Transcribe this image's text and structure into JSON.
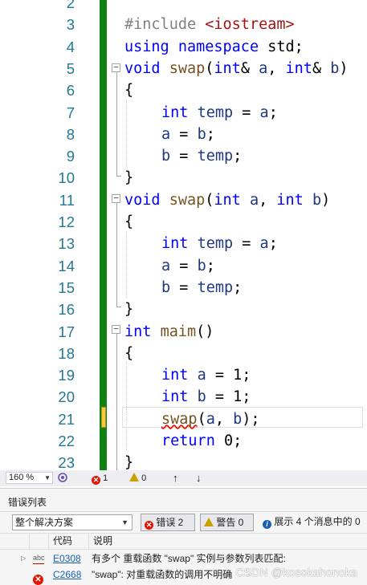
{
  "editor": {
    "lines": [
      {
        "num": "2",
        "indent": 0,
        "tokens": []
      },
      {
        "num": "3",
        "indent": 0,
        "tokens": [
          {
            "t": "#include ",
            "c": "pp"
          },
          {
            "t": "<iostream>",
            "c": "str"
          }
        ]
      },
      {
        "num": "4",
        "indent": 0,
        "tokens": [
          {
            "t": "using",
            "c": "kw"
          },
          {
            "t": " "
          },
          {
            "t": "namespace",
            "c": "kw"
          },
          {
            "t": " std;"
          }
        ]
      },
      {
        "num": "5",
        "indent": 0,
        "tokens": [
          {
            "t": "void",
            "c": "kw"
          },
          {
            "t": " "
          },
          {
            "t": "swap",
            "c": "fn"
          },
          {
            "t": "("
          },
          {
            "t": "int",
            "c": "kw"
          },
          {
            "t": "& "
          },
          {
            "t": "a",
            "c": "var"
          },
          {
            "t": ", "
          },
          {
            "t": "int",
            "c": "kw"
          },
          {
            "t": "& "
          },
          {
            "t": "b",
            "c": "var"
          },
          {
            "t": ")"
          }
        ]
      },
      {
        "num": "6",
        "indent": 0,
        "tokens": [
          {
            "t": "{"
          }
        ]
      },
      {
        "num": "7",
        "indent": 1,
        "tokens": [
          {
            "t": "int",
            "c": "kw"
          },
          {
            "t": " "
          },
          {
            "t": "temp",
            "c": "var"
          },
          {
            "t": " = "
          },
          {
            "t": "a",
            "c": "var"
          },
          {
            "t": ";"
          }
        ]
      },
      {
        "num": "8",
        "indent": 1,
        "tokens": [
          {
            "t": "a",
            "c": "var"
          },
          {
            "t": " = "
          },
          {
            "t": "b",
            "c": "var"
          },
          {
            "t": ";"
          }
        ]
      },
      {
        "num": "9",
        "indent": 1,
        "tokens": [
          {
            "t": "b",
            "c": "var"
          },
          {
            "t": " = "
          },
          {
            "t": "temp",
            "c": "var"
          },
          {
            "t": ";"
          }
        ]
      },
      {
        "num": "10",
        "indent": 0,
        "tokens": [
          {
            "t": "}"
          }
        ]
      },
      {
        "num": "11",
        "indent": 0,
        "tokens": [
          {
            "t": "void",
            "c": "kw"
          },
          {
            "t": " "
          },
          {
            "t": "swap",
            "c": "fn"
          },
          {
            "t": "("
          },
          {
            "t": "int",
            "c": "kw"
          },
          {
            "t": " "
          },
          {
            "t": "a",
            "c": "var"
          },
          {
            "t": ", "
          },
          {
            "t": "int",
            "c": "kw"
          },
          {
            "t": " "
          },
          {
            "t": "b",
            "c": "var"
          },
          {
            "t": ")"
          }
        ]
      },
      {
        "num": "12",
        "indent": 0,
        "tokens": [
          {
            "t": "{"
          }
        ]
      },
      {
        "num": "13",
        "indent": 1,
        "tokens": [
          {
            "t": "int",
            "c": "kw"
          },
          {
            "t": " "
          },
          {
            "t": "temp",
            "c": "var"
          },
          {
            "t": " = "
          },
          {
            "t": "a",
            "c": "var"
          },
          {
            "t": ";"
          }
        ]
      },
      {
        "num": "14",
        "indent": 1,
        "tokens": [
          {
            "t": "a",
            "c": "var"
          },
          {
            "t": " = "
          },
          {
            "t": "b",
            "c": "var"
          },
          {
            "t": ";"
          }
        ]
      },
      {
        "num": "15",
        "indent": 1,
        "tokens": [
          {
            "t": "b",
            "c": "var"
          },
          {
            "t": " = "
          },
          {
            "t": "temp",
            "c": "var"
          },
          {
            "t": ";"
          }
        ]
      },
      {
        "num": "16",
        "indent": 0,
        "tokens": [
          {
            "t": "}"
          }
        ]
      },
      {
        "num": "17",
        "indent": 0,
        "tokens": [
          {
            "t": "int",
            "c": "kw"
          },
          {
            "t": " "
          },
          {
            "t": "maim",
            "c": "fn"
          },
          {
            "t": "()"
          }
        ]
      },
      {
        "num": "18",
        "indent": 0,
        "tokens": [
          {
            "t": "{"
          }
        ]
      },
      {
        "num": "19",
        "indent": 1,
        "tokens": [
          {
            "t": "int",
            "c": "kw"
          },
          {
            "t": " "
          },
          {
            "t": "a",
            "c": "var"
          },
          {
            "t": " = 1;"
          }
        ]
      },
      {
        "num": "20",
        "indent": 1,
        "tokens": [
          {
            "t": "int",
            "c": "kw"
          },
          {
            "t": " "
          },
          {
            "t": "b",
            "c": "var"
          },
          {
            "t": " = 1;"
          }
        ]
      },
      {
        "num": "21",
        "indent": 1,
        "tokens": [
          {
            "t": "swap",
            "c": "fn err"
          },
          {
            "t": "("
          },
          {
            "t": "a",
            "c": "var"
          },
          {
            "t": ", "
          },
          {
            "t": "b",
            "c": "var"
          },
          {
            "t": ");"
          }
        ]
      },
      {
        "num": "22",
        "indent": 1,
        "tokens": [
          {
            "t": "return",
            "c": "kw"
          },
          {
            "t": " 0;"
          }
        ]
      },
      {
        "num": "23",
        "indent": 0,
        "tokens": [
          {
            "t": "}"
          }
        ]
      }
    ]
  },
  "status": {
    "zoom": "160 %",
    "error_count": "1",
    "warning_count": "0",
    "up_arrow": "↑",
    "down_arrow": "↓"
  },
  "error_list": {
    "title": "错误列表",
    "scope": "整个解决方案",
    "errors_button": "错误 2",
    "warnings_button": "警告 0",
    "messages_filter": "展示 4 个消息中的 0",
    "columns": {
      "code": "代码",
      "description": "说明"
    },
    "rows": [
      {
        "code": "E0308",
        "description": "有多个 重载函数 \"swap\" 实例与参数列表匹配:",
        "icon": "spelling-icon"
      },
      {
        "code": "C2668",
        "description": "\"swap\": 对重载函数的调用不明确",
        "icon": "error-icon"
      }
    ]
  },
  "watermark": "CSDN @kosokahonoka",
  "colors": {
    "keyword": "#0000ff",
    "function": "#74531f",
    "variable": "#1f377f",
    "preprocessor": "#808080",
    "string": "#a31515",
    "line_number": "#237893",
    "change_bar": "#108010",
    "error": "#e51400"
  }
}
